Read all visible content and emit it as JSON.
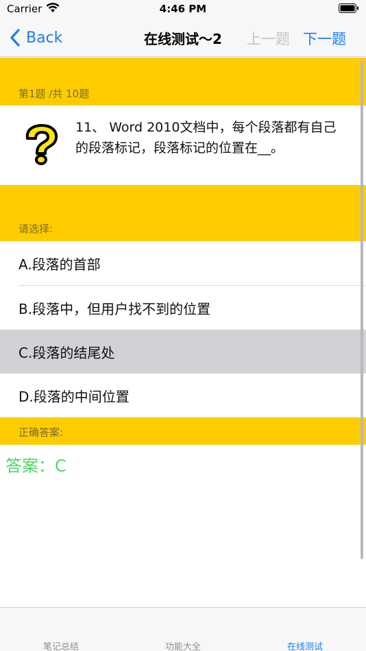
{
  "status_bar": {
    "carrier": "Carrier",
    "time": "4:46 PM"
  },
  "nav": {
    "back_label": "Back",
    "title": "在线测试～2",
    "prev_label": "上一题",
    "next_label": "下一题"
  },
  "question": {
    "progress": "第1题 /共 10题",
    "icon": "question-mark-icon",
    "text": "11、 Word 2010文档中，每个段落都有自己的段落标记，段落标记的位置在__。"
  },
  "choices": {
    "header": "请选择:",
    "options": [
      {
        "label": "A.段落的首部"
      },
      {
        "label": "B.段落中，但用户找不到的位置"
      },
      {
        "label": "C.段落的结尾处",
        "selected": true
      },
      {
        "label": "D.段落的中间位置"
      }
    ]
  },
  "answer": {
    "header": "正确答案:",
    "text": "答案：C"
  },
  "tabs": [
    {
      "label": "笔记总结"
    },
    {
      "label": "功能大全"
    },
    {
      "label": "在线测试",
      "active": true
    }
  ],
  "colors": {
    "accent": "#1a7cf5",
    "section_bg": "#ffcc00",
    "answer": "#4cd964",
    "selected_row": "#d1d1d6"
  }
}
